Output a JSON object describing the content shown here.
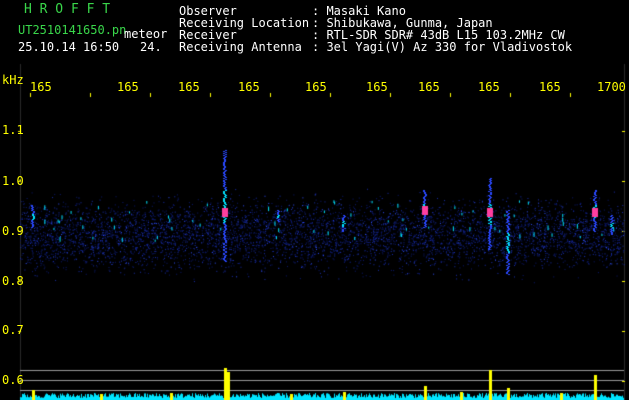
{
  "header": {
    "station_title": "H R O F F T",
    "filename": "UT2510141650.pn",
    "mode": "meteor",
    "datetime": "25.10.14 16:50",
    "count": "24.",
    "info_labels": [
      "Observer",
      "Receiving Location",
      "Receiver",
      "Receiving Antenna"
    ],
    "info_values": [
      ": Masaki Kano",
      ": Shibukawa, Gunma, Japan",
      ": RTL-SDR SDR# 43dB L15 103.2MHz CW",
      ": 3el Yagi(V) Az 330 for Vladivostok"
    ]
  },
  "axes": {
    "y_unit": "kHz",
    "y_ticks": [
      "1.1",
      "1.0",
      "0.9",
      "0.8",
      "0.7",
      "0.6"
    ],
    "x_ticks": [
      "165",
      "165",
      "165",
      "165",
      "165",
      "165",
      "165",
      "165",
      "165",
      "1700"
    ]
  },
  "colors": {
    "background": "#000000",
    "header_green": "#39d64a",
    "label_yellow": "#ffff00",
    "signal_cyan": "#00e5ff",
    "meteor_magenta": "#ff3fa0",
    "noise_blue": "#1530c0",
    "baseline_yellow": "#ffff00"
  }
}
